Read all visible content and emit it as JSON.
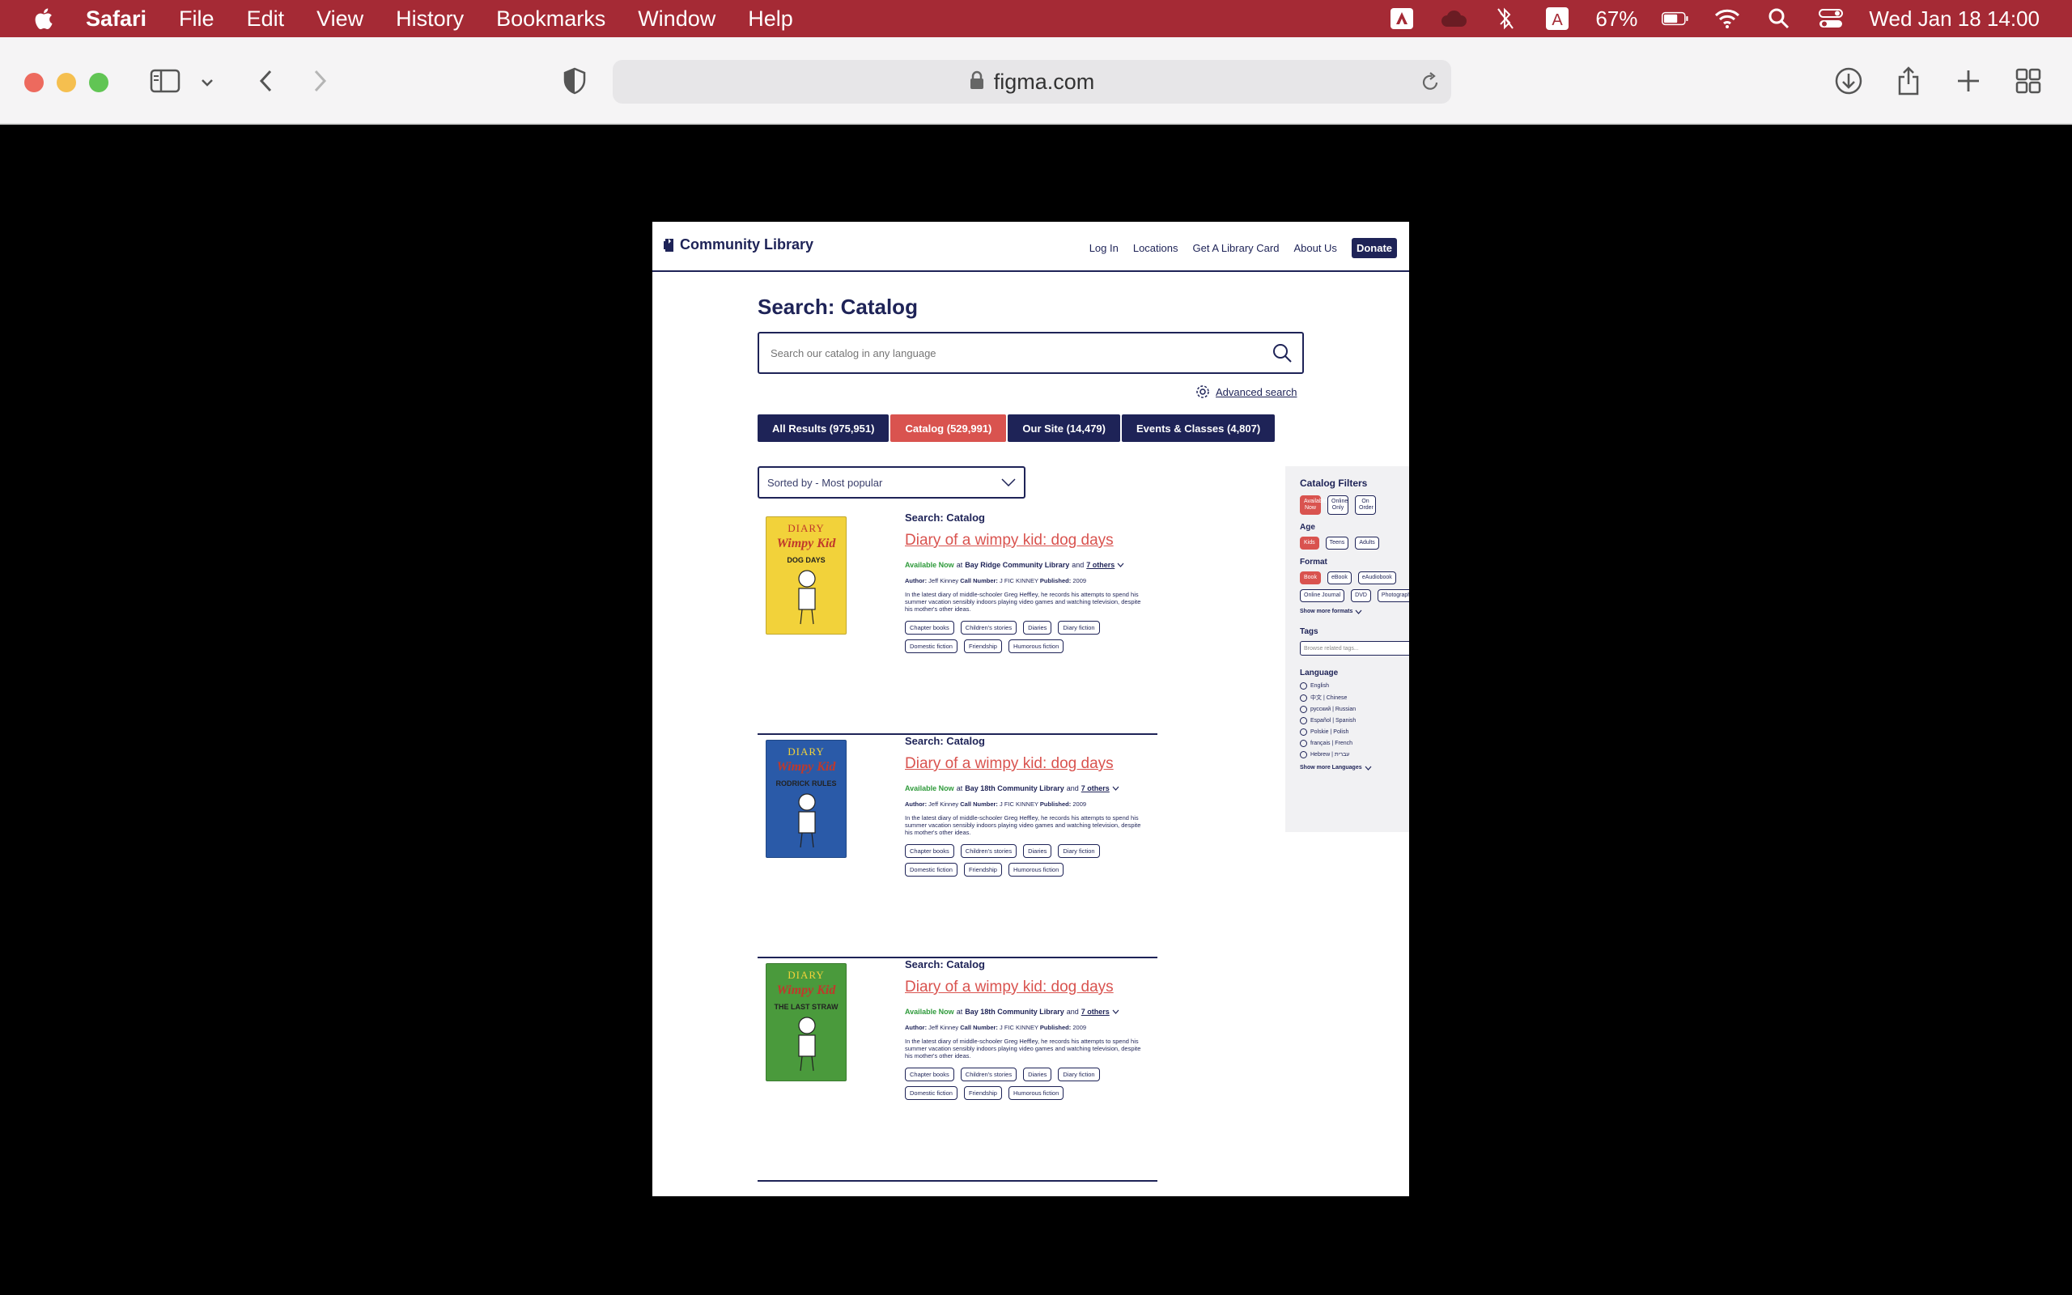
{
  "menubar": {
    "app_name": "Safari",
    "items": [
      "File",
      "Edit",
      "View",
      "History",
      "Bookmarks",
      "Window",
      "Help"
    ],
    "battery": "67%",
    "datetime": "Wed Jan 18  14:00"
  },
  "browser": {
    "url": "figma.com"
  },
  "site": {
    "name": "Community Library",
    "nav": [
      "Log In",
      "Locations",
      "Get A Library Card",
      "About Us"
    ],
    "donate": "Donate"
  },
  "search": {
    "title": "Search: Catalog",
    "placeholder": "Search our catalog in any language",
    "advanced": "Advanced search",
    "tabs": [
      {
        "label": "All Results (975,951)"
      },
      {
        "label": "Catalog (529,991)"
      },
      {
        "label": "Our Site (14,479)"
      },
      {
        "label": "Events & Classes (4,807)"
      }
    ],
    "active_tab": 1,
    "sort": "Sorted by - Most popular"
  },
  "results": [
    {
      "kicker": "Search: Catalog",
      "title": "Diary of a wimpy kid: dog days",
      "available": "Available Now",
      "at": "at",
      "library": "Bay Ridge Community Library",
      "and": "and",
      "others": "7 others",
      "author_label": "Author:",
      "author": "Jeff Kinney",
      "call_label": "Call Number:",
      "call": "J FIC KINNEY",
      "pub_label": "Published:",
      "published": "2009",
      "description": "In the latest diary of middle-schooler Greg Heffley, he records his attempts to spend his summer vacation sensibly indoors playing video games and watching television, despite his mother's other ideas.",
      "tags": [
        "Chapter books",
        "Children's stories",
        "Diaries",
        "Diary fiction",
        "Domestic fiction",
        "Friendship",
        "Humorous fiction"
      ],
      "cover": {
        "diary": "DIARY",
        "wimpy": "Wimpy Kid",
        "sub": "DOG DAYS",
        "color": "#f2d23a",
        "text": "#c0392b"
      }
    },
    {
      "kicker": "Search: Catalog",
      "title": "Diary of a wimpy kid: dog days",
      "available": "Available Now",
      "at": "at",
      "library": "Bay 18th Community Library",
      "and": "and",
      "others": "7 others",
      "author_label": "Author:",
      "author": "Jeff Kinney",
      "call_label": "Call Number:",
      "call": "J FIC KINNEY",
      "pub_label": "Published:",
      "published": "2009",
      "description": "In the latest diary of middle-schooler Greg Heffley, he records his attempts to spend his summer vacation sensibly indoors playing video games and watching television, despite his mother's other ideas.",
      "tags": [
        "Chapter books",
        "Children's stories",
        "Diaries",
        "Diary fiction",
        "Domestic fiction",
        "Friendship",
        "Humorous fiction"
      ],
      "cover": {
        "diary": "DIARY",
        "wimpy": "Wimpy Kid",
        "sub": "RODRICK RULES",
        "color": "#2a5aa8",
        "text": "#f2d23a"
      }
    },
    {
      "kicker": "Search: Catalog",
      "title": "Diary of a wimpy kid: dog days",
      "available": "Available Now",
      "at": "at",
      "library": "Bay 18th Community Library",
      "and": "and",
      "others": "7 others",
      "author_label": "Author:",
      "author": "Jeff Kinney",
      "call_label": "Call Number:",
      "call": "J FIC KINNEY",
      "pub_label": "Published:",
      "published": "2009",
      "description": "In the latest diary of middle-schooler Greg Heffley, he records his attempts to spend his summer vacation sensibly indoors playing video games and watching television, despite his mother's other ideas.",
      "tags": [
        "Chapter books",
        "Children's stories",
        "Diaries",
        "Diary fiction",
        "Domestic fiction",
        "Friendship",
        "Humorous fiction"
      ],
      "cover": {
        "diary": "DIARY",
        "wimpy": "Wimpy Kid",
        "sub": "THE LAST STRAW",
        "color": "#4a9a3c",
        "text": "#f2d23a"
      }
    }
  ],
  "filters": {
    "title": "Catalog Filters",
    "availability": [
      {
        "label": "Available Now",
        "on": true
      },
      {
        "label": "Online Only",
        "on": false
      },
      {
        "label": "On Order",
        "on": false
      }
    ],
    "age_title": "Age",
    "age": [
      {
        "label": "Kids",
        "on": true
      },
      {
        "label": "Teens",
        "on": false
      },
      {
        "label": "Adults",
        "on": false
      }
    ],
    "format_title": "Format",
    "format": [
      {
        "label": "Book",
        "on": true
      },
      {
        "label": "eBook",
        "on": false
      },
      {
        "label": "eAudiobook",
        "on": false
      },
      {
        "label": "Online Journal",
        "on": false
      },
      {
        "label": "DVD",
        "on": false
      },
      {
        "label": "Photograph",
        "on": false
      }
    ],
    "more_formats": "Show more formats",
    "tags_title": "Tags",
    "tags_placeholder": "Browse related tags...",
    "language_title": "Language",
    "languages": [
      "English",
      "中文 | Chinese",
      "русский | Russian",
      "Español | Spanish",
      "Polskie | Polish",
      "français | French",
      "Hebrew | עברית"
    ],
    "more_languages": "Show more Languages"
  },
  "colors": {
    "menubar": "#a52a35",
    "navy": "#1e2357",
    "accent": "#d9534f",
    "available": "#2e9a3a"
  }
}
